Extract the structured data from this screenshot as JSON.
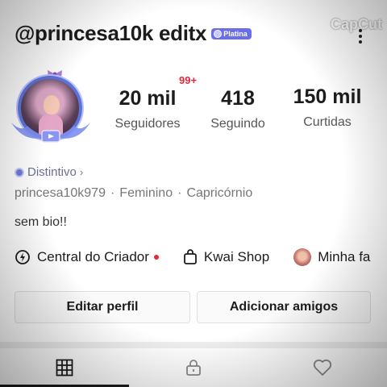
{
  "header": {
    "username": "@princesa10k editx",
    "badge_label": "Platina",
    "more_icon": "more-vertical-icon"
  },
  "watermark": {
    "label": "CapCut",
    "icon": "capcut-logo-icon"
  },
  "avatar": {
    "icon": "avatar-frame-icon"
  },
  "notification_badge": "99+",
  "stats": {
    "followers": {
      "value": "20 mil",
      "label": "Seguidores"
    },
    "following": {
      "value": "418",
      "label": "Seguindo"
    },
    "likes": {
      "value": "150 mil",
      "label": "Curtidas"
    }
  },
  "distintivo": {
    "label": "Distintivo",
    "chevron": "›"
  },
  "meta": {
    "id": "princesa10k979",
    "gender": "Feminino",
    "sign": "Capricórnio",
    "separator": "·"
  },
  "bio": "sem bio!!",
  "links": [
    {
      "label": "Central do Criador",
      "icon": "creator-center-icon"
    },
    {
      "label": "Kwai Shop",
      "icon": "shopping-bag-icon"
    },
    {
      "label": "Minha fa",
      "icon": "family-avatar-icon"
    }
  ],
  "actions": {
    "edit_label": "Editar perfil",
    "add_label": "Adicionar amigos"
  },
  "tabs": [
    {
      "name": "grid",
      "icon": "grid-icon",
      "active": true
    },
    {
      "name": "private",
      "icon": "lock-icon",
      "active": false
    },
    {
      "name": "liked",
      "icon": "heart-icon",
      "active": false
    }
  ],
  "colors": {
    "badge_bg": "#6b6ee6",
    "notification": "#e8263a",
    "text_primary": "#1c1c1c",
    "text_secondary": "#777777"
  }
}
